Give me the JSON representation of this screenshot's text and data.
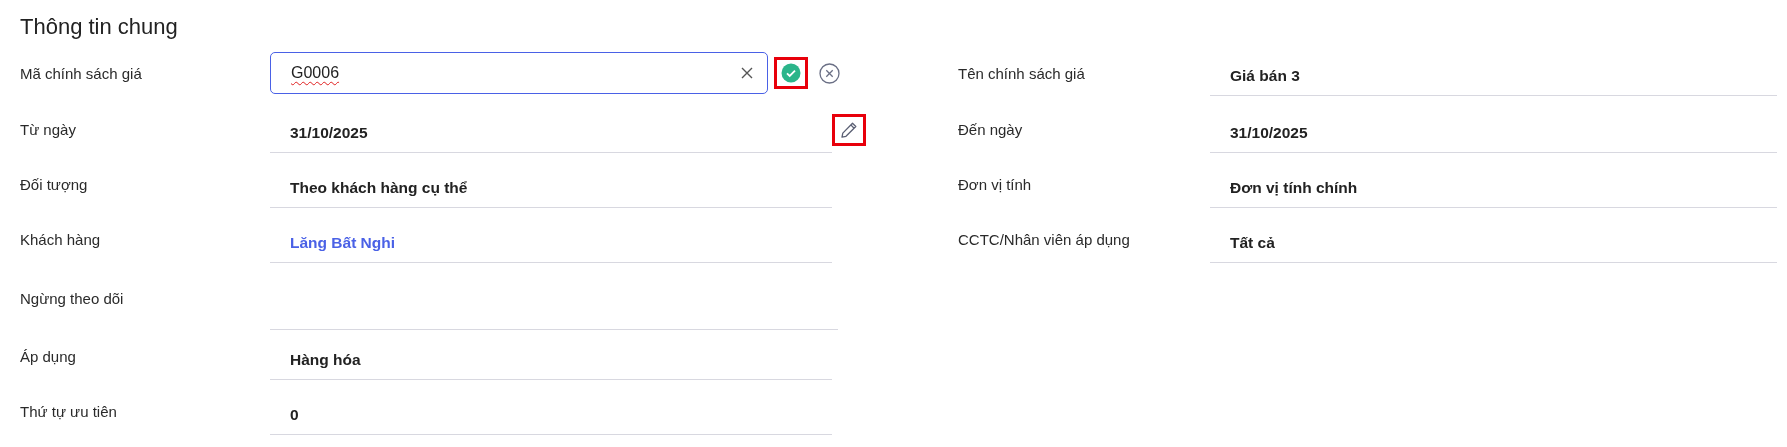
{
  "section_title": "Thông tin chung",
  "left_fields": [
    {
      "label": "Mã chính sách giá",
      "kind": "input",
      "value": "G0006",
      "actions": [
        {
          "kind": "confirm",
          "highlighted": true
        },
        {
          "kind": "cancel",
          "highlighted": false
        }
      ]
    },
    {
      "label": "Từ ngày",
      "kind": "text",
      "value": "31/10/2025",
      "actions": [
        {
          "kind": "edit",
          "highlighted": true
        }
      ]
    },
    {
      "label": "Đối tượng",
      "kind": "text",
      "value": "Theo khách hàng cụ thể"
    },
    {
      "label": "Khách hàng",
      "kind": "link",
      "value": "Lăng Bất Nghi"
    },
    {
      "label": "Ngừng theo dõi",
      "kind": "empty"
    },
    {
      "label": "Áp dụng",
      "kind": "text",
      "value": "Hàng hóa"
    },
    {
      "label": "Thứ tự ưu tiên",
      "kind": "text",
      "value": "0"
    }
  ],
  "right_fields": [
    {
      "label": "Tên chính sách giá",
      "kind": "text",
      "value": "Giá bán 3"
    },
    {
      "label": "Đến ngày",
      "kind": "text",
      "value": "31/10/2025"
    },
    {
      "label": "Đơn vị tính",
      "kind": "text",
      "value": "Đơn vị tính chính"
    },
    {
      "label": "CCTC/Nhân viên áp dụng",
      "kind": "text",
      "value": "Tất cả"
    }
  ]
}
